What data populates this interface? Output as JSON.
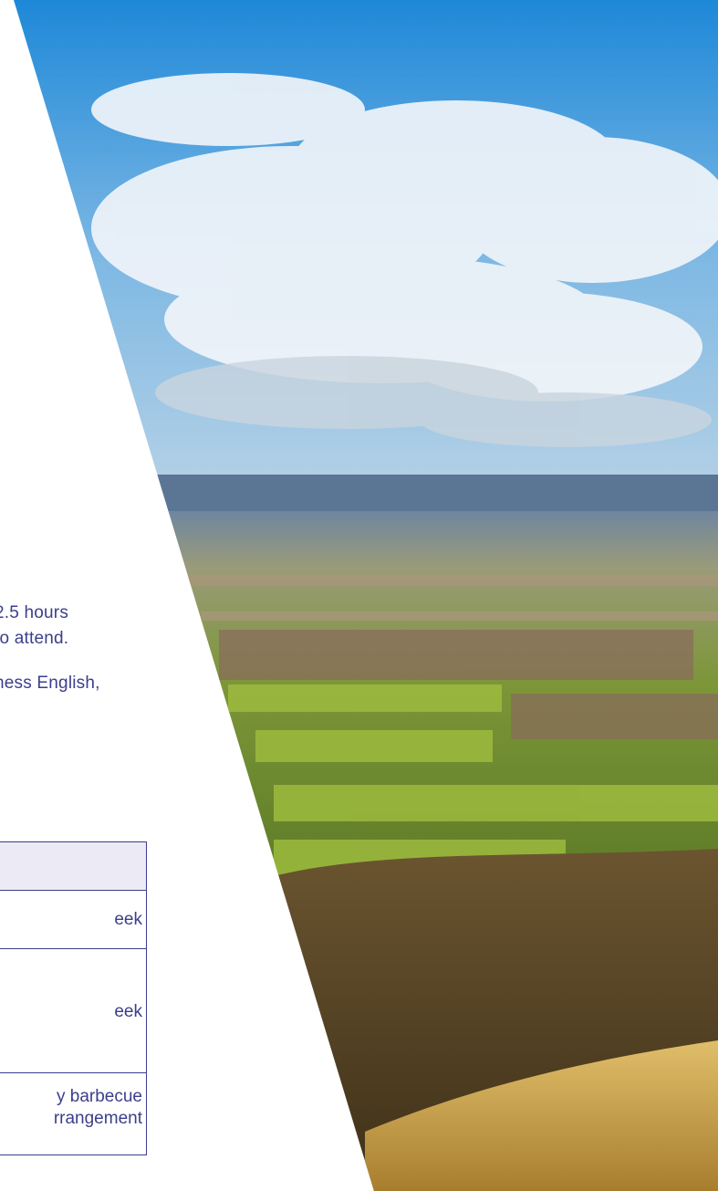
{
  "intro": {
    "lines": [
      "2.5 hours",
      "to attend.",
      "ness English,"
    ]
  },
  "table": {
    "rows": [
      {
        "lines": [
          "eek"
        ]
      },
      {
        "lines": [
          "eek"
        ]
      },
      {
        "lines": [
          "y barbecue",
          "rrangement"
        ]
      }
    ]
  },
  "photo": {
    "subject": "countryside landscape",
    "sky_color": "#2a8fd6",
    "grass_color": "#7a9a2c"
  }
}
